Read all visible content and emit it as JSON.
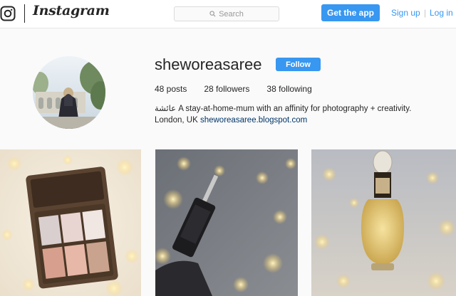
{
  "nav": {
    "wordmark": "Instagram",
    "search_placeholder": "Search",
    "get_app_label": "Get the app",
    "signup_label": "Sign up",
    "separator": "|",
    "login_label": "Log in",
    "accent_color": "#3897f0"
  },
  "profile": {
    "username": "sheworeasaree",
    "follow_label": "Follow",
    "posts": "48 posts",
    "followers": "28 followers",
    "following": "38 following",
    "bio_line1": "عائشة A stay-at-home-mum with an affinity for photography + creativity.",
    "bio_location": "London, UK",
    "bio_link": "sheworeasaree.blogspot.com"
  },
  "grid": {
    "posts": [
      {
        "subject": "makeup palette with fairy lights"
      },
      {
        "subject": "perfume dropper with fairy lights"
      },
      {
        "subject": "golden perfume bottle with fairy lights"
      }
    ]
  }
}
